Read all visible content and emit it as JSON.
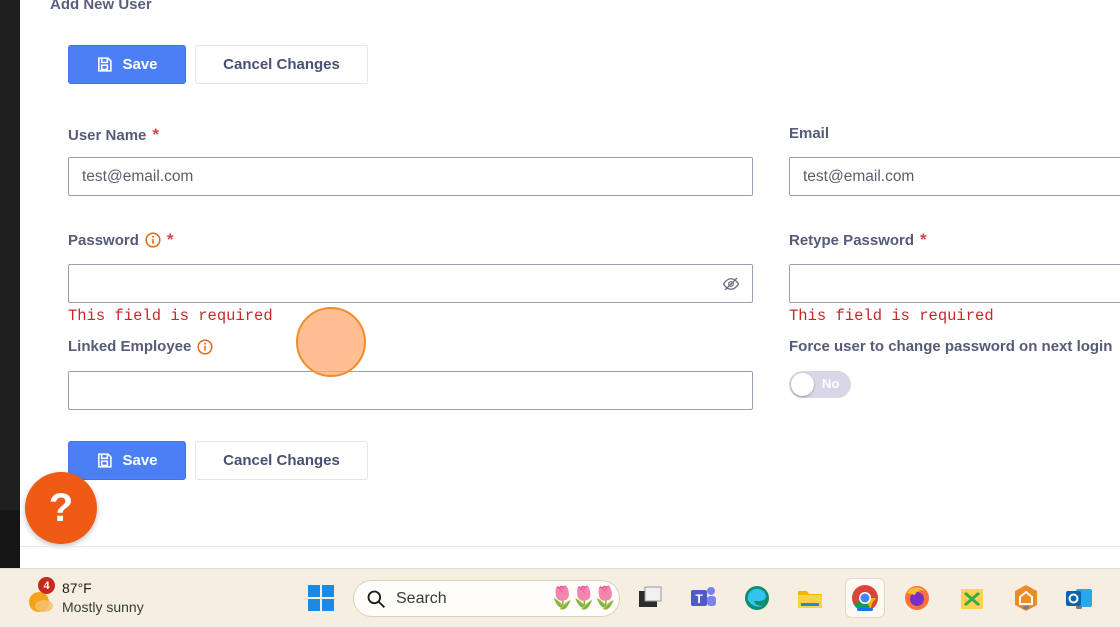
{
  "page": {
    "title": "Add New User"
  },
  "toolbar_top": {
    "save_label": "Save",
    "cancel_label": "Cancel Changes"
  },
  "toolbar_bottom": {
    "save_label": "Save",
    "cancel_label": "Cancel Changes"
  },
  "form": {
    "user_name": {
      "label": "User Name",
      "required_mark": "*",
      "value": "test@email.com"
    },
    "email": {
      "label": "Email",
      "value": "test@email.com"
    },
    "password": {
      "label": "Password",
      "required_mark": "*",
      "value": "",
      "error": "This field is required"
    },
    "retype_password": {
      "label": "Retype Password",
      "required_mark": "*",
      "value": "",
      "error": "This field is required"
    },
    "linked_employee": {
      "label": "Linked Employee",
      "value": ""
    },
    "force_change": {
      "label": "Force user to change password on next login",
      "toggle_text": "No",
      "enabled": false
    }
  },
  "help": {
    "label": "?"
  },
  "taskbar": {
    "weather": {
      "badge": "4",
      "temp": "87°F",
      "condition": "Mostly sunny"
    },
    "search": {
      "placeholder": "Search"
    },
    "apps": [
      "start-icon",
      "task-view-icon",
      "teams-icon",
      "edge-icon",
      "file-explorer-icon",
      "chrome-icon",
      "firefox-icon",
      "snipping-tool-icon",
      "vpn-icon",
      "outlook-icon"
    ]
  },
  "colors": {
    "primary": "#4c7ff4",
    "error": "#c62828",
    "help": "#ef5a14",
    "required": "#d64545",
    "info": "#e06a1b"
  }
}
